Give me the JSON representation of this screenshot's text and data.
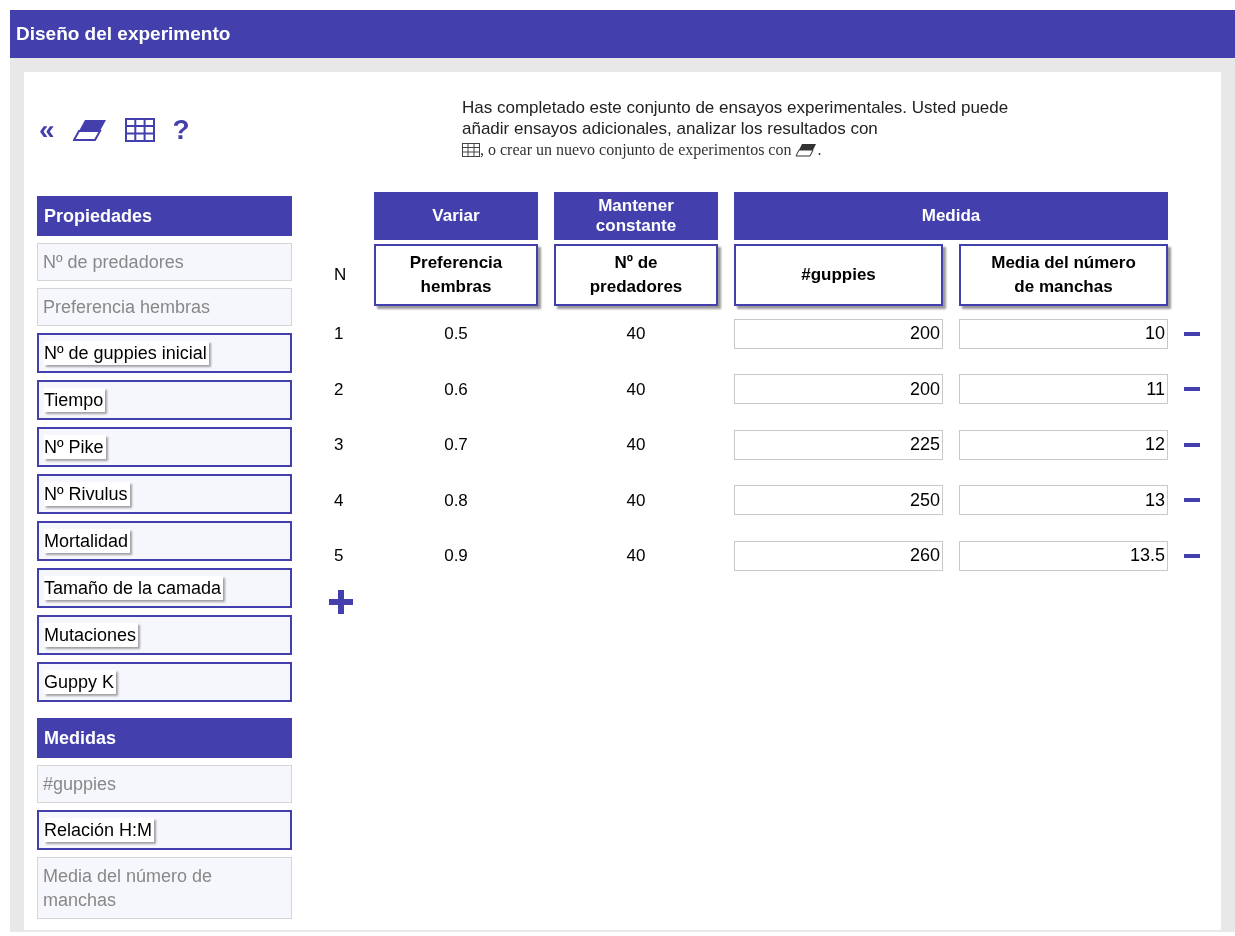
{
  "window": {
    "title": "Diseño del experimento"
  },
  "toolbar": [
    {
      "kind": "text",
      "label": "«"
    },
    {
      "kind": "eraser"
    },
    {
      "kind": "table"
    },
    {
      "kind": "text",
      "label": "?"
    }
  ],
  "message": {
    "text": "Has completado este conjunto de ensayos experimentales. Usted puede añadir ensayos adicionales, analizar los resultados con",
    "after_table": ", o crear un nuevo conjunto de experimentos con",
    "end": "."
  },
  "sidebar": [
    {
      "title": "Propiedades",
      "items": [
        {
          "label": "Nº de predadores",
          "in_use": true
        },
        {
          "label": "Preferencia hembras",
          "in_use": true
        },
        {
          "label": "Nº de guppies inicial",
          "in_use": false
        },
        {
          "label": "Tiempo",
          "in_use": false
        },
        {
          "label": "Nº Pike",
          "in_use": false
        },
        {
          "label": "Nº Rivulus",
          "in_use": false
        },
        {
          "label": "Mortalidad",
          "in_use": false
        },
        {
          "label": "Tamaño de la camada",
          "in_use": false
        },
        {
          "label": "Mutaciones",
          "in_use": false
        },
        {
          "label": "Guppy K",
          "in_use": false
        }
      ]
    },
    {
      "title": "Medidas",
      "items": [
        {
          "label": "#guppies",
          "in_use": true
        },
        {
          "label": "Relación H:M",
          "in_use": false
        },
        {
          "label": "Media del número de manchas",
          "in_use": true
        }
      ]
    }
  ],
  "table": {
    "n_label": "N",
    "groups": [
      {
        "label": "Variar",
        "columns": [
          {
            "label": "Preferencia hembras",
            "kind": "fixed"
          }
        ]
      },
      {
        "label": "Mantener constante",
        "columns": [
          {
            "label": "Nº de predadores",
            "kind": "fixed"
          }
        ]
      },
      {
        "label": "Medida",
        "columns": [
          {
            "label": "#guppies",
            "kind": "input"
          },
          {
            "label": "Media del número de manchas",
            "kind": "input"
          }
        ]
      }
    ],
    "rows": [
      {
        "cells": [
          "1",
          "0.5",
          "40",
          "200",
          "10"
        ]
      },
      {
        "cells": [
          "2",
          "0.6",
          "40",
          "200",
          "11"
        ]
      },
      {
        "cells": [
          "3",
          "0.7",
          "40",
          "225",
          "12"
        ]
      },
      {
        "cells": [
          "4",
          "0.8",
          "40",
          "250",
          "13"
        ]
      },
      {
        "cells": [
          "5",
          "0.9",
          "40",
          "260",
          "13.5"
        ]
      }
    ]
  }
}
